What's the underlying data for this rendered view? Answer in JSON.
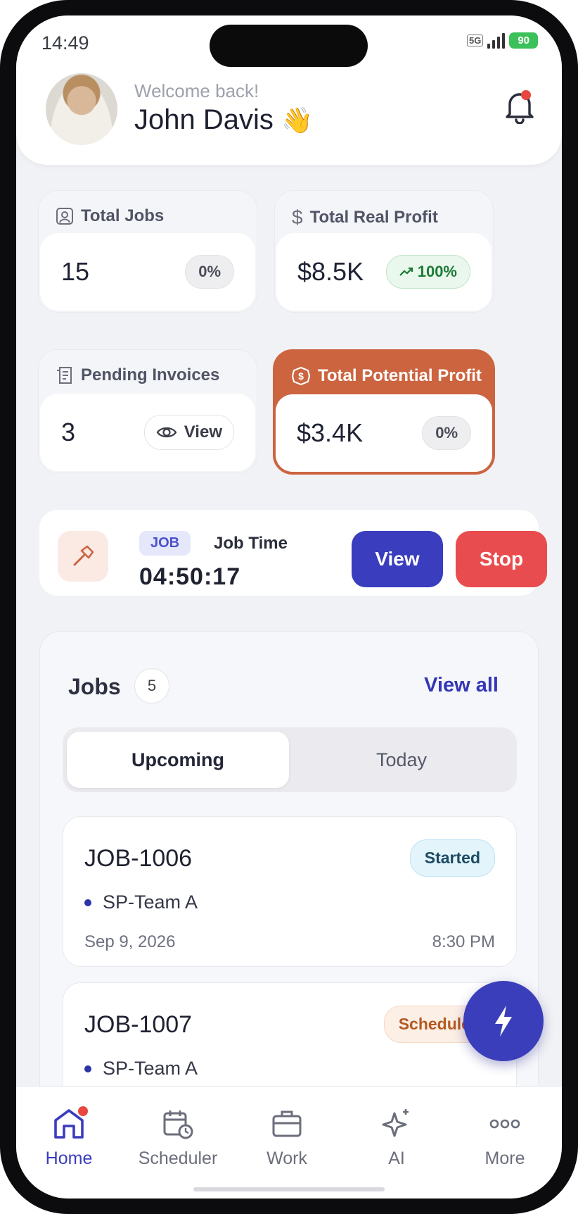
{
  "status_bar": {
    "time": "14:49",
    "network": "5G",
    "battery": "90"
  },
  "header": {
    "welcome": "Welcome back!",
    "user_name": "John Davis",
    "wave_emoji": "👋",
    "notification_icon": "bell-icon"
  },
  "stats": {
    "total_jobs": {
      "label": "Total Jobs",
      "value": "15",
      "change": "0%"
    },
    "total_real_profit": {
      "label": "Total Real Profit",
      "value": "$8.5K",
      "change": "100%"
    },
    "pending_invoices": {
      "label": "Pending Invoices",
      "value": "3",
      "action": "View"
    },
    "total_potential_profit": {
      "label": "Total Potential Profit",
      "value": "$3.4K",
      "change": "0%"
    }
  },
  "timer": {
    "tag": "JOB",
    "label": "Job Time",
    "elapsed": "04:50:17",
    "view_label": "View",
    "stop_label": "Stop"
  },
  "jobs": {
    "title": "Jobs",
    "count": "5",
    "view_all": "View all",
    "tabs": [
      {
        "label": "Upcoming",
        "active": true
      },
      {
        "label": "Today",
        "active": false
      }
    ],
    "items": [
      {
        "id": "JOB-1006",
        "status": "Started",
        "team": "SP-Team A",
        "date": "Sep 9, 2026",
        "time": "8:30 PM"
      },
      {
        "id": "JOB-1007",
        "status": "Scheduled",
        "team": "SP-Team A",
        "date": "",
        "time": ""
      }
    ]
  },
  "nav": [
    {
      "label": "Home",
      "icon": "home-icon",
      "active": true
    },
    {
      "label": "Scheduler",
      "icon": "calendar-clock-icon",
      "active": false
    },
    {
      "label": "Work",
      "icon": "briefcase-icon",
      "active": false
    },
    {
      "label": "AI",
      "icon": "sparkle-icon",
      "active": false
    },
    {
      "label": "More",
      "icon": "more-icon",
      "active": false
    }
  ],
  "colors": {
    "primary": "#3a3dbd",
    "danger": "#e94c4e",
    "accent_orange": "#cc6440",
    "success": "#1e7a37"
  }
}
